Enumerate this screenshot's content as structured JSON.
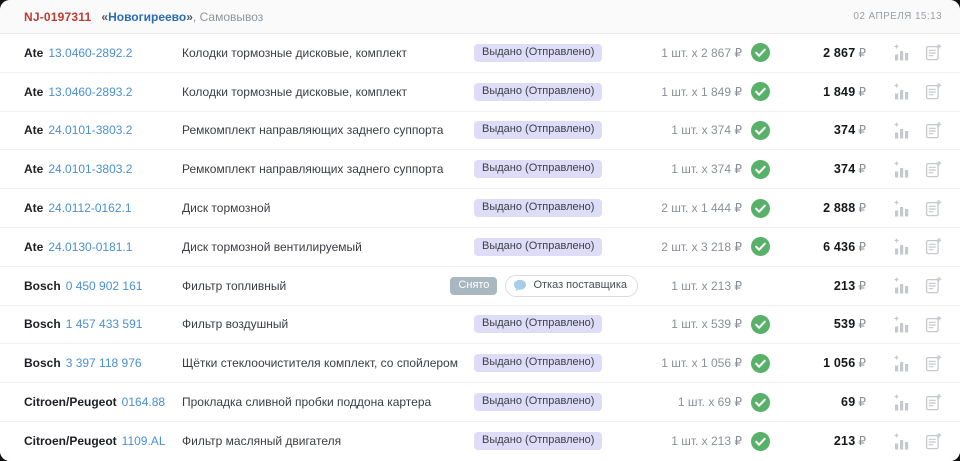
{
  "header": {
    "order_id": "NJ-0197311",
    "warehouse_open": "«",
    "warehouse_name": "Новогиреево",
    "warehouse_close": "»",
    "delivery": ", Самовывоз",
    "datetime": "02 АПРЕЛЯ 15:13"
  },
  "colors": {
    "order_id_red": "#c13a31",
    "warehouse_blue": "#2a6cb4",
    "article_link_blue": "#4a90d2",
    "badge_issued_bg": "#dfdcf7",
    "badge_removed_bg": "#a9b7c1",
    "check_green": "#57b168",
    "comment_bubble_blue": "#a5cdea",
    "action_icon_gray": "#c5c8cc"
  },
  "icons": {
    "confirmed": "check-circle-icon",
    "note": "comment-bubble-icon",
    "stats": "price-stats-bar-chart-plus-icon",
    "add_doc": "add-to-document-plus-icon"
  },
  "rows": [
    {
      "brand": "Ate",
      "article": "13.0460-2892.2",
      "description": "Колодки тормозные дисковые, комплект",
      "status": "Выдано (Отправлено)",
      "status_type": "issued",
      "qty": "1 шт. x 2 867 ₽",
      "confirmed": true,
      "price": "2 867",
      "currency": "₽"
    },
    {
      "brand": "Ate",
      "article": "13.0460-2893.2",
      "description": "Колодки тормозные дисковые, комплект",
      "status": "Выдано (Отправлено)",
      "status_type": "issued",
      "qty": "1 шт. x 1 849 ₽",
      "confirmed": true,
      "price": "1 849",
      "currency": "₽"
    },
    {
      "brand": "Ate",
      "article": "24.0101-3803.2",
      "description": "Ремкомплект направляющих заднего суппорта",
      "status": "Выдано (Отправлено)",
      "status_type": "issued",
      "qty": "1 шт. x 374 ₽",
      "confirmed": true,
      "price": "374",
      "currency": "₽"
    },
    {
      "brand": "Ate",
      "article": "24.0101-3803.2",
      "description": "Ремкомплект направляющих заднего суппорта",
      "status": "Выдано (Отправлено)",
      "status_type": "issued",
      "qty": "1 шт. x 374 ₽",
      "confirmed": true,
      "price": "374",
      "currency": "₽"
    },
    {
      "brand": "Ate",
      "article": "24.0112-0162.1",
      "description": "Диск тормозной",
      "status": "Выдано (Отправлено)",
      "status_type": "issued",
      "qty": "2 шт. x 1 444 ₽",
      "confirmed": true,
      "price": "2 888",
      "currency": "₽"
    },
    {
      "brand": "Ate",
      "article": "24.0130-0181.1",
      "description": "Диск тормозной вентилируемый",
      "status": "Выдано (Отправлено)",
      "status_type": "issued",
      "qty": "2 шт. x 3 218 ₽",
      "confirmed": true,
      "price": "6 436",
      "currency": "₽"
    },
    {
      "brand": "Bosch",
      "article": "0 450 902 161",
      "description": "Фильтр топливный",
      "status": "Снято",
      "status_type": "removed",
      "note": "Отказ поставщика",
      "qty": "1 шт. x 213 ₽",
      "confirmed": false,
      "price": "213",
      "currency": "₽"
    },
    {
      "brand": "Bosch",
      "article": "1 457 433 591",
      "description": "Фильтр воздушный",
      "status": "Выдано (Отправлено)",
      "status_type": "issued",
      "qty": "1 шт. x 539 ₽",
      "confirmed": true,
      "price": "539",
      "currency": "₽"
    },
    {
      "brand": "Bosch",
      "article": "3 397 118 976",
      "description": "Щётки стеклоочистителя комплект, со спойлером",
      "status": "Выдано (Отправлено)",
      "status_type": "issued",
      "qty": "1 шт. x 1 056 ₽",
      "confirmed": true,
      "price": "1 056",
      "currency": "₽"
    },
    {
      "brand": "Citroen/Peugeot",
      "article": "0164.88",
      "description": "Прокладка сливной пробки поддона картера",
      "status": "Выдано (Отправлено)",
      "status_type": "issued",
      "qty": "1 шт. x 69 ₽",
      "confirmed": true,
      "price": "69",
      "currency": "₽"
    },
    {
      "brand": "Citroen/Peugeot",
      "article": "1109.AL",
      "description": "Фильтр масляный двигателя",
      "status": "Выдано (Отправлено)",
      "status_type": "issued",
      "qty": "1 шт. x 213 ₽",
      "confirmed": true,
      "price": "213",
      "currency": "₽"
    }
  ]
}
